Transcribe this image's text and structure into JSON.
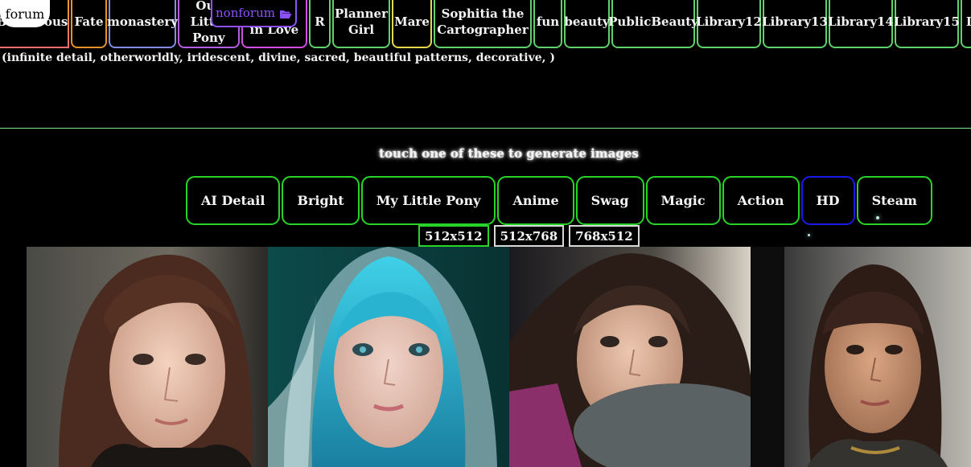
{
  "tabs": [
    {
      "label": "Beauteous",
      "color": "rainbow"
    },
    {
      "label": "Fate",
      "color": "orange"
    },
    {
      "label": "monastery",
      "color": "blue"
    },
    {
      "label": "Our\nLittle\nPony",
      "color": "purple"
    },
    {
      "label": "Bears\nin Love",
      "color": "magenta"
    },
    {
      "label": "R",
      "color": "green"
    },
    {
      "label": "Planner\nGirl",
      "color": "green"
    },
    {
      "label": "Mare",
      "color": "yellow"
    },
    {
      "label": "Sophitia the\nCartographer",
      "color": "green"
    },
    {
      "label": "fun",
      "color": "green"
    },
    {
      "label": "beauty",
      "color": "green"
    },
    {
      "label": "PublicBeauty",
      "color": "green"
    },
    {
      "label": "Library12",
      "color": "green"
    },
    {
      "label": "Library13",
      "color": "green"
    },
    {
      "label": "Library14",
      "color": "green"
    },
    {
      "label": "Library15",
      "color": "green"
    },
    {
      "label": "Li",
      "color": "green"
    }
  ],
  "forum_label": "forum",
  "nonforum_label": "nonforum",
  "nonforum_icon": "folder-open-icon",
  "prompt_text": "(infinite detail, otherworldly, iridescent, divine, sacred, beautiful patterns, decorative, )",
  "instruction": "touch one of these to generate images",
  "styles": [
    {
      "label": "AI Detail"
    },
    {
      "label": "Bright"
    },
    {
      "label": "My Little Pony"
    },
    {
      "label": "Anime"
    },
    {
      "label": "Swag"
    },
    {
      "label": "Magic"
    },
    {
      "label": "Action"
    },
    {
      "label": "HD"
    },
    {
      "label": "Steam"
    }
  ],
  "sizes": [
    {
      "label": "512x512",
      "selected": true
    },
    {
      "label": "512x768",
      "selected": false
    },
    {
      "label": "768x512",
      "selected": false
    }
  ],
  "colors": {
    "background": "#000000",
    "tab_border": "#5fd06a",
    "style_border": "#27d427",
    "hd_border": "#1a1ae6",
    "nonforum": "#8c52ff"
  },
  "gallery": [
    {
      "name": "portrait-brunette-side-light"
    },
    {
      "name": "portrait-teal-hair-veil"
    },
    {
      "name": "portrait-dark-hair-car"
    },
    {
      "name": "portrait-bangs-window"
    }
  ]
}
